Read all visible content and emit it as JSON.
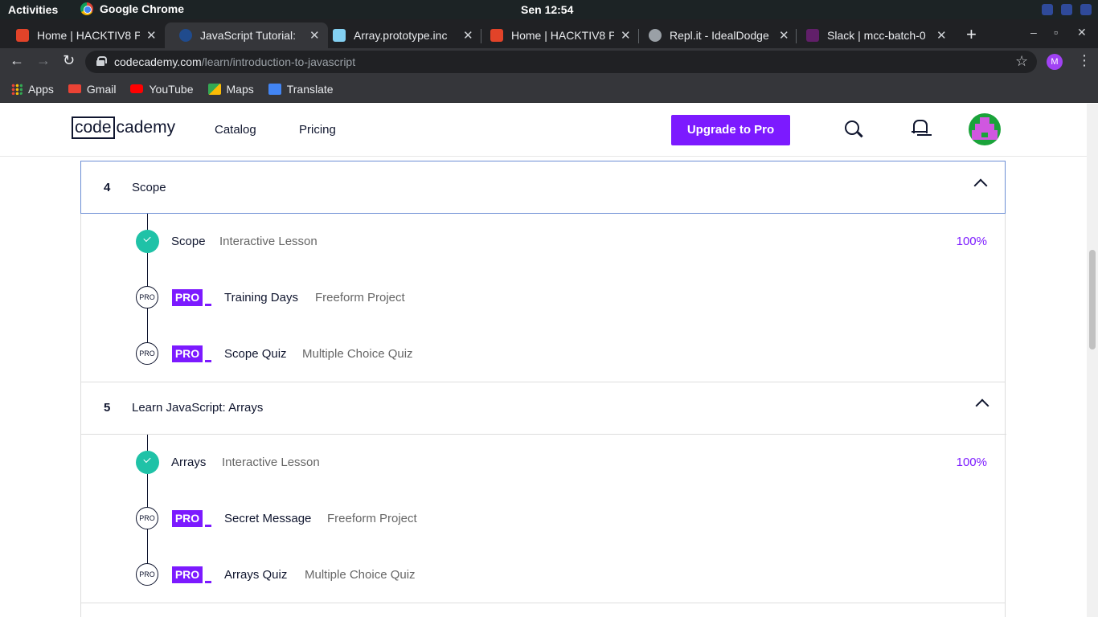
{
  "gnome": {
    "activities": "Activities",
    "app_name": "Google Chrome",
    "clock": "Sen 12:54"
  },
  "tabs": [
    {
      "title": "Home | HACKTIV8 P",
      "favicon": "gitlab-icon",
      "color": "#e24329"
    },
    {
      "title": "JavaScript Tutorial:",
      "favicon": "codecademy-icon",
      "color": "#204b8d"
    },
    {
      "title": "Array.prototype.inc",
      "favicon": "mdn-icon",
      "color": "#83d0f2"
    },
    {
      "title": "Home | HACKTIV8 P",
      "favicon": "gitlab-icon",
      "color": "#e24329"
    },
    {
      "title": "Repl.it - IdealDodge",
      "favicon": "replit-icon",
      "color": "#9aa0a6"
    },
    {
      "title": "Slack | mcc-batch-0",
      "favicon": "slack-icon",
      "color": "#611f69"
    }
  ],
  "address": {
    "host": "codecademy.com",
    "path": "/learn/introduction-to-javascript"
  },
  "profile_initial": "M",
  "bookmarks": [
    {
      "label": "Apps",
      "icon": "apps-grid-icon"
    },
    {
      "label": "Gmail",
      "icon": "gmail-icon",
      "color": "#ea4335"
    },
    {
      "label": "YouTube",
      "icon": "youtube-icon",
      "color": "#ff0000"
    },
    {
      "label": "Maps",
      "icon": "maps-icon",
      "color": "#34a853"
    },
    {
      "label": "Translate",
      "icon": "translate-icon",
      "color": "#4285f4"
    }
  ],
  "header": {
    "logo_box": "code",
    "logo_rest": "cademy",
    "nav": [
      "Catalog",
      "Pricing"
    ],
    "upgrade_label": "Upgrade to Pro",
    "accent": "#7c1aff"
  },
  "modules": [
    {
      "number": "4",
      "title": "Scope",
      "items": [
        {
          "title": "Scope",
          "type": "Interactive Lesson",
          "status": "complete",
          "progress": "100%"
        },
        {
          "title": "Training Days",
          "type": "Freeform Project",
          "status": "pro",
          "pro_label": "PRO"
        },
        {
          "title": "Scope Quiz",
          "type": "Multiple Choice Quiz",
          "status": "pro",
          "pro_label": "PRO"
        }
      ]
    },
    {
      "number": "5",
      "title": "Learn JavaScript: Arrays",
      "items": [
        {
          "title": "Arrays",
          "type": "Interactive Lesson",
          "status": "complete",
          "progress": "100%"
        },
        {
          "title": "Secret Message",
          "type": "Freeform Project",
          "status": "pro",
          "pro_label": "PRO"
        },
        {
          "title": "Arrays Quiz",
          "type": "Multiple Choice Quiz",
          "status": "pro",
          "pro_label": "PRO"
        }
      ]
    }
  ],
  "pro_circle_label": "PRO"
}
